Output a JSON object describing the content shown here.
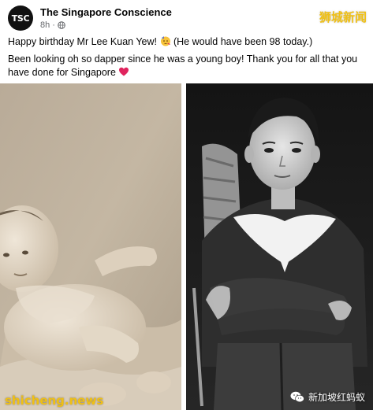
{
  "post": {
    "avatar_text": "TSC",
    "page_name": "The Singapore Conscience",
    "time": "8h",
    "visibility_icon": "globe-icon",
    "line1_a": "Happy birthday Mr Lee Kuan Yew!",
    "line1_emoji": "partying-face-emoji",
    "line1_b": "(He would have been 98 today.)",
    "line2_a": "Been looking oh so dapper since he was a young boy! Thank you for all that you have done for Singapore",
    "line2_emoji": "red-heart-emoji"
  },
  "watermarks": {
    "top_right": "狮城新闻",
    "bottom_left": "shicheng.news",
    "bottom_right": "新加坡红蚂蚁",
    "bottom_right_icon": "wechat-icon"
  },
  "photos": [
    {
      "name": "baby-photo",
      "tone": "sepia"
    },
    {
      "name": "boy-photo",
      "tone": "black-and-white"
    }
  ],
  "colors": {
    "watermark_yellow": "#f0c014",
    "meta_gray": "#65676b",
    "heart_red": "#e0245e"
  }
}
